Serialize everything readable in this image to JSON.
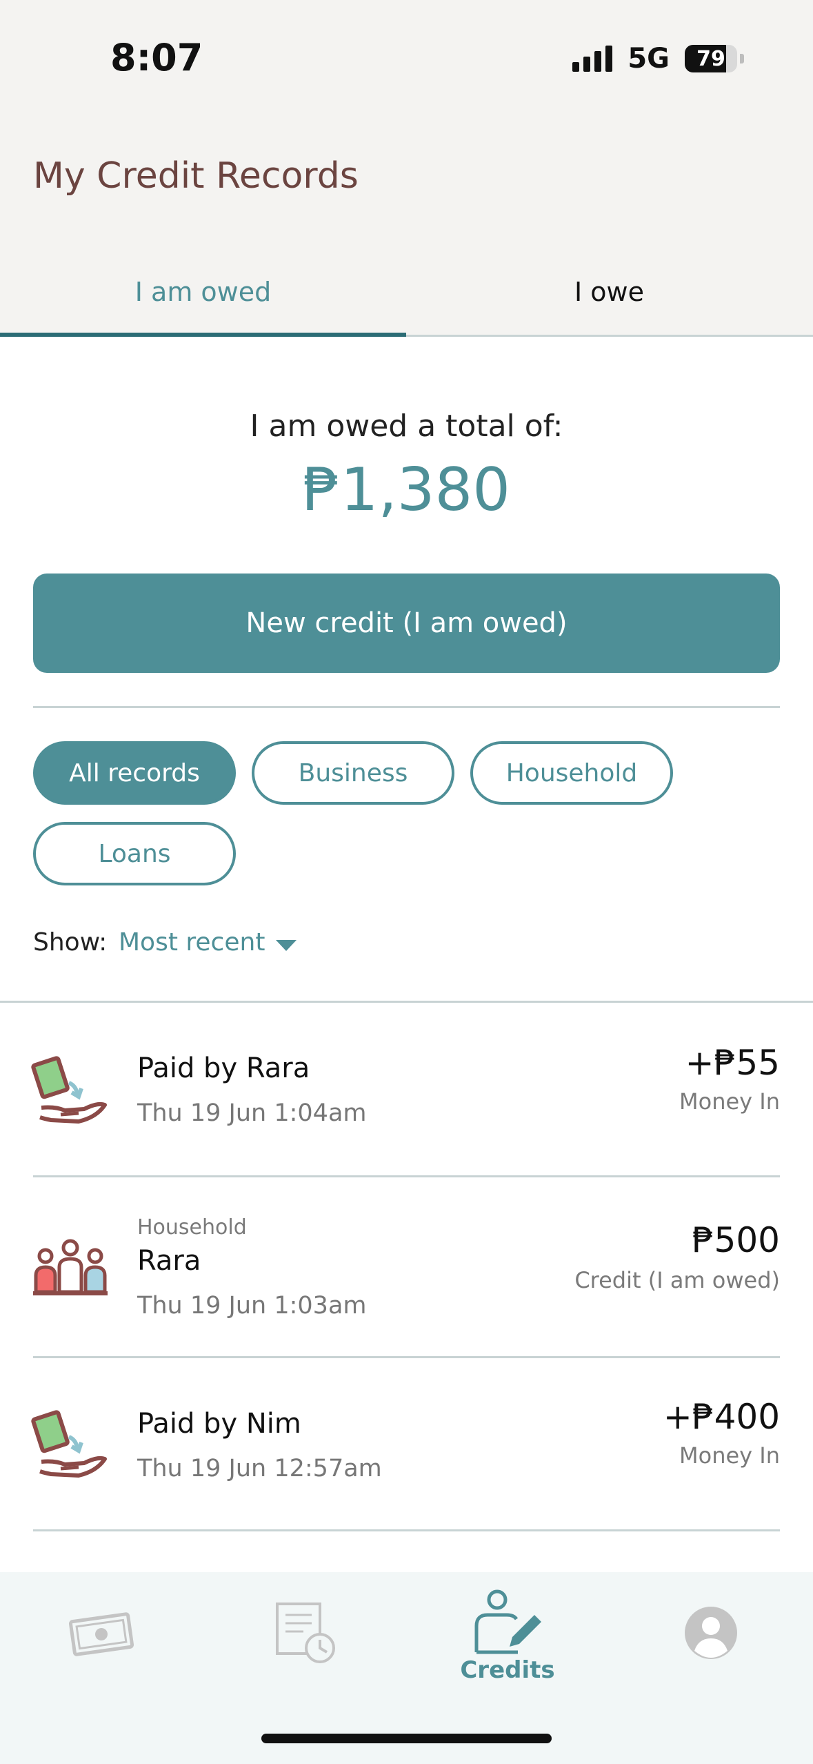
{
  "status_bar": {
    "time": "8:07",
    "network": "5G",
    "battery": "79"
  },
  "header": {
    "title": "My Credit Records"
  },
  "tabs": [
    {
      "label": "I am owed",
      "active": true
    },
    {
      "label": "I owe",
      "active": false
    }
  ],
  "summary": {
    "label": "I am owed a total of:",
    "total": "₱1,380"
  },
  "actions": {
    "new_credit_label": "New credit (I am owed)"
  },
  "filters": {
    "chips": [
      {
        "label": "All records",
        "active": true
      },
      {
        "label": "Business",
        "active": false
      },
      {
        "label": "Household",
        "active": false
      },
      {
        "label": "Loans",
        "active": false
      }
    ],
    "show_label": "Show:",
    "show_value": "Most recent"
  },
  "records": [
    {
      "category": "",
      "title": "Paid by Rara",
      "date": "Thu 19 Jun 1:04am",
      "amount": "+₱55",
      "type": "Money In",
      "icon": "money-received-icon"
    },
    {
      "category": "Household",
      "title": "Rara",
      "date": "Thu 19 Jun 1:03am",
      "amount": "₱500",
      "type": "Credit (I am owed)",
      "icon": "household-icon"
    },
    {
      "category": "",
      "title": "Paid by Nim",
      "date": "Thu 19 Jun 12:57am",
      "amount": "+₱400",
      "type": "Money In",
      "icon": "money-received-icon"
    }
  ],
  "bottom_nav": [
    {
      "label": "",
      "icon": "cash-icon",
      "active": false
    },
    {
      "label": "",
      "icon": "history-icon",
      "active": false
    },
    {
      "label": "Credits",
      "icon": "credits-icon",
      "active": true
    },
    {
      "label": "",
      "icon": "profile-icon",
      "active": false
    }
  ],
  "colors": {
    "accent": "#4e8f97",
    "title": "#6b4440",
    "icon_brown": "#8b4a47"
  }
}
